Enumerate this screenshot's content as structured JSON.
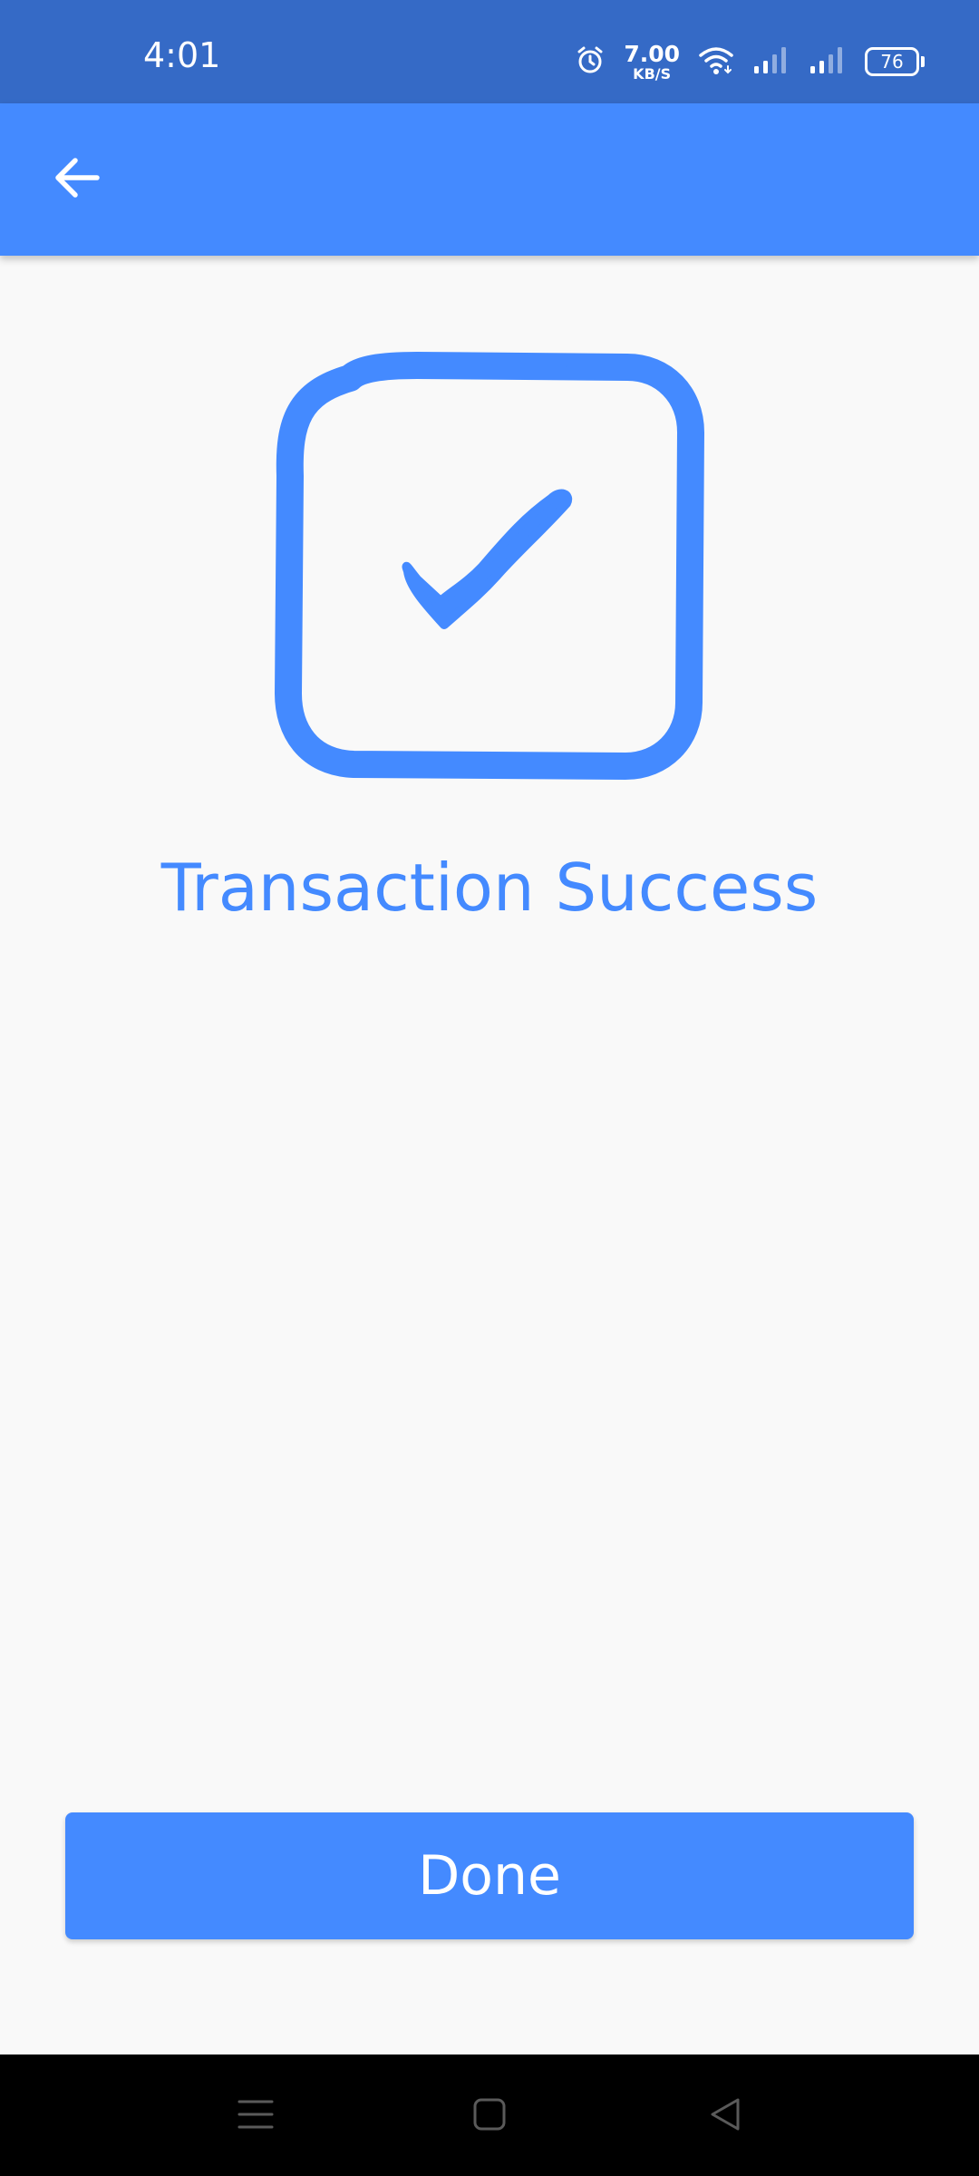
{
  "status_bar": {
    "time": "4:01",
    "net_speed_value": "7.00",
    "net_speed_unit": "KB/S",
    "battery_level": "76",
    "icons": [
      "alarm-icon",
      "wifi-icon",
      "signal-icon",
      "signal-icon",
      "battery-icon"
    ]
  },
  "app_bar": {
    "back_icon": "arrow-left-icon"
  },
  "main": {
    "status_icon": "checkbox-checked-icon",
    "title": "Transaction Success"
  },
  "actions": {
    "done_label": "Done"
  },
  "nav_bar": {
    "icons": [
      "menu-icon",
      "home-icon",
      "back-triangle-icon"
    ]
  },
  "colors": {
    "accent": "#448aff",
    "status_bar": "#356ac6",
    "background": "#f9f9f9",
    "nav_bar": "#000000"
  }
}
